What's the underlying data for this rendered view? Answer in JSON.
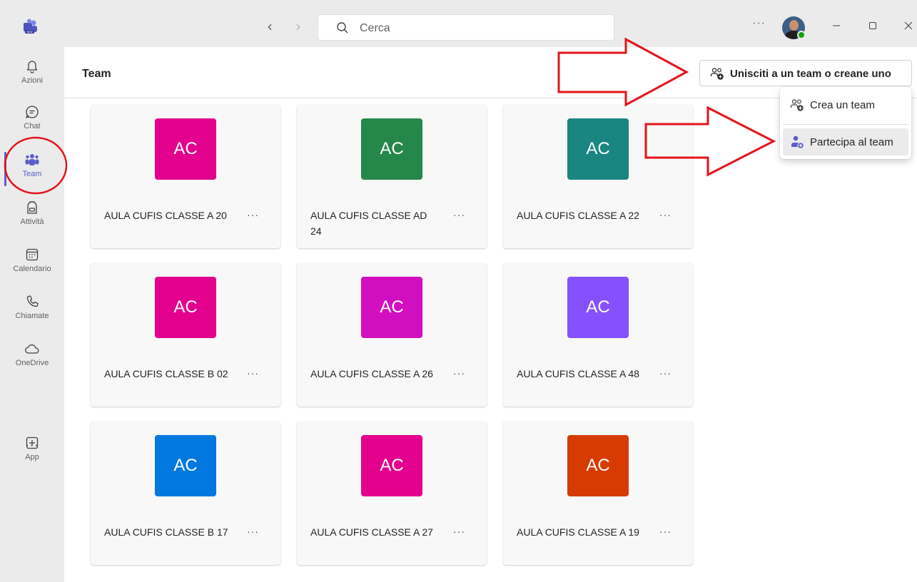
{
  "titlebar": {
    "search_placeholder": "Cerca",
    "more_label": "···"
  },
  "rail": {
    "items": [
      {
        "label": "Azioni",
        "icon": "bell-icon"
      },
      {
        "label": "Chat",
        "icon": "chat-icon"
      },
      {
        "label": "Team",
        "icon": "teams-icon",
        "active": true
      },
      {
        "label": "Attività",
        "icon": "backpack-icon"
      },
      {
        "label": "Calendario",
        "icon": "calendar-icon"
      },
      {
        "label": "Chiamate",
        "icon": "phone-icon"
      },
      {
        "label": "OneDrive",
        "icon": "cloud-icon"
      }
    ],
    "more_label": "···",
    "app": {
      "label": "App",
      "icon": "add-app-icon"
    }
  },
  "header": {
    "title": "Team",
    "join_button_label": "Unisciti a un team o creane uno"
  },
  "menu": {
    "items": [
      {
        "label": "Crea un team",
        "icon": "people-add-icon"
      },
      {
        "label": "Partecipa al team",
        "icon": "person-join-icon",
        "highlighted": true
      }
    ]
  },
  "teams": [
    {
      "initials": "AC",
      "name": "AULA CUFIS CLASSE A 20",
      "color": "#e3008c"
    },
    {
      "initials": "AC",
      "name": "AULA CUFIS CLASSE AD 24",
      "color": "#258749"
    },
    {
      "initials": "AC",
      "name": "AULA CUFIS CLASSE A 22",
      "color": "#1a8581"
    },
    {
      "initials": "AC",
      "name": "AULA CUFIS CLASSE B 02",
      "color": "#e3008c"
    },
    {
      "initials": "AC",
      "name": "AULA CUFIS CLASSE A 26",
      "color": "#d10fc0"
    },
    {
      "initials": "AC",
      "name": "AULA CUFIS CLASSE A 48",
      "color": "#8750ff"
    },
    {
      "initials": "AC",
      "name": "AULA CUFIS CLASSE B 17",
      "color": "#0078e0"
    },
    {
      "initials": "AC",
      "name": "AULA CUFIS CLASSE A 27",
      "color": "#e3008c"
    },
    {
      "initials": "AC",
      "name": "AULA CUFIS CLASSE A 19",
      "color": "#d83b01"
    }
  ],
  "card_more_label": "···",
  "colors": {
    "accent": "#5b5fc7",
    "annotation_red": "#e3141b"
  }
}
